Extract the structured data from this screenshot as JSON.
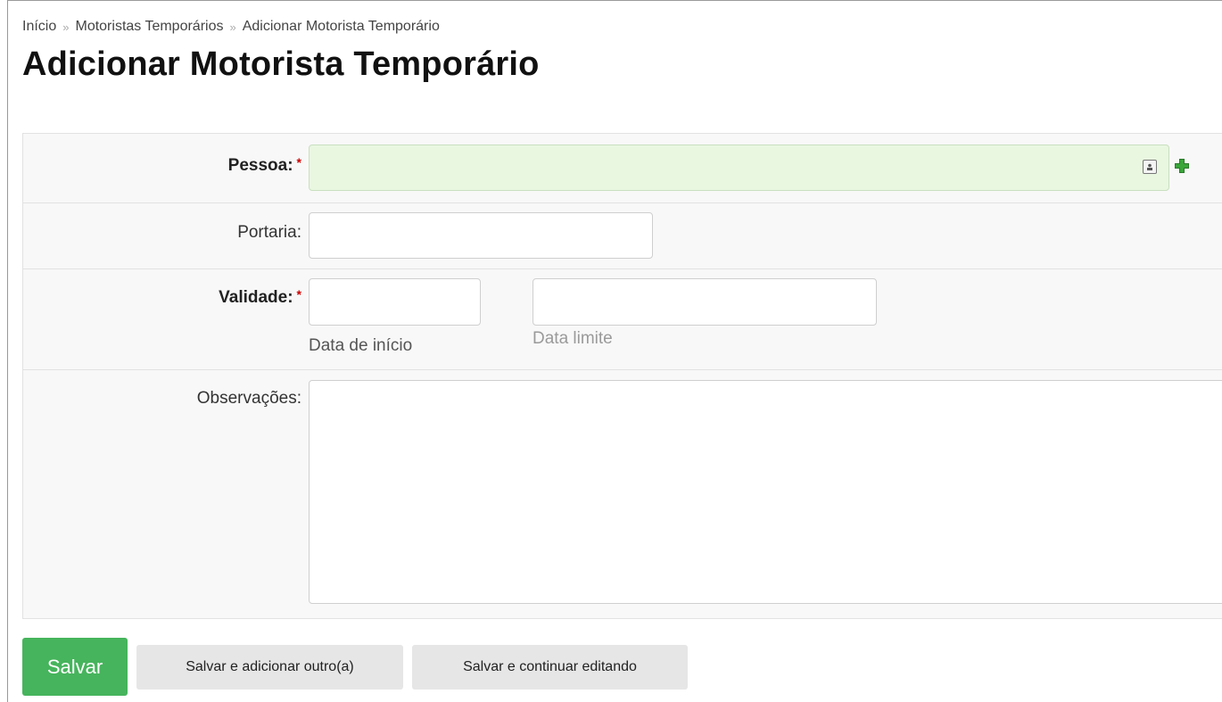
{
  "breadcrumb": {
    "items": [
      "Início",
      "Motoristas Temporários",
      "Adicionar Motorista Temporário"
    ],
    "separator": "»"
  },
  "page": {
    "title": "Adicionar Motorista Temporário"
  },
  "form": {
    "pessoa": {
      "label": "Pessoa:",
      "required_mark": "*",
      "value": "",
      "lookup_icon": "lookup-icon",
      "add_icon": "add-plus-icon"
    },
    "portaria": {
      "label": "Portaria:",
      "value": ""
    },
    "validade": {
      "label": "Validade:",
      "required_mark": "*",
      "start": {
        "value": "",
        "help": "Data de início"
      },
      "end": {
        "value": "",
        "help": "Data limite"
      }
    },
    "observacoes": {
      "label": "Observações:",
      "value": ""
    }
  },
  "actions": {
    "save": "Salvar",
    "save_add_another": "Salvar e adicionar outro(a)",
    "save_continue": "Salvar e continuar editando"
  },
  "colors": {
    "primary_button": "#46b45c",
    "autocomplete_bg": "#e9f7e1",
    "required": "#cc0000",
    "add_icon": "#3aa63a"
  }
}
